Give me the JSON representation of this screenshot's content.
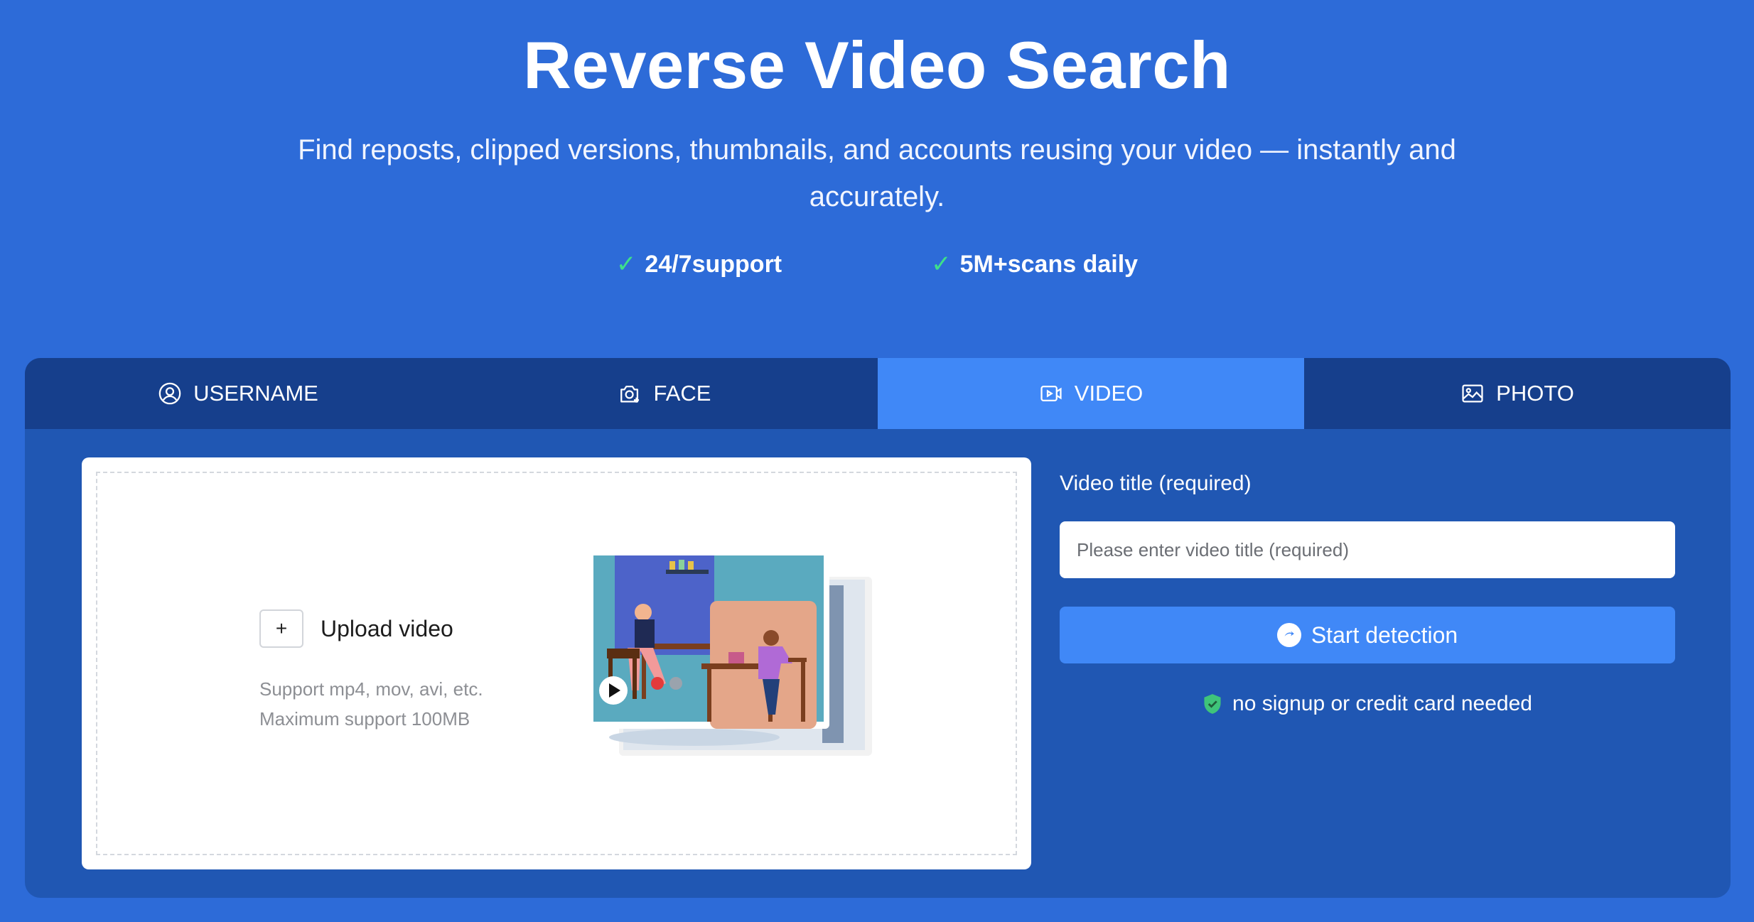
{
  "hero": {
    "title": "Reverse Video Search",
    "subtitle": "Find reposts, clipped versions, thumbnails, and accounts reusing your video — instantly and accurately.",
    "features": [
      {
        "check": "✓",
        "label": "24/7support"
      },
      {
        "check": "✓",
        "label": "5M+scans daily"
      }
    ]
  },
  "tabs": [
    {
      "label": "USERNAME",
      "icon": "user-circle-icon",
      "active": false
    },
    {
      "label": "FACE",
      "icon": "face-scan-icon",
      "active": false
    },
    {
      "label": "VIDEO",
      "icon": "video-icon",
      "active": true
    },
    {
      "label": "PHOTO",
      "icon": "image-icon",
      "active": false
    }
  ],
  "upload": {
    "plus": "+",
    "label": "Upload video",
    "hint_formats": "Support mp4, mov, avi, etc.",
    "hint_size": "Maximum support 100MB"
  },
  "form": {
    "title_label": "Video title (required)",
    "title_value": "",
    "title_placeholder": "Please enter video title (required)",
    "start_label": "Start detection",
    "note": "no signup or credit card needed"
  },
  "colors": {
    "page_bg": "#2d6bd8",
    "panel_bg": "#2057b3",
    "tab_bar": "#163f8c",
    "accent": "#4088f7",
    "check": "#3ee08a"
  }
}
